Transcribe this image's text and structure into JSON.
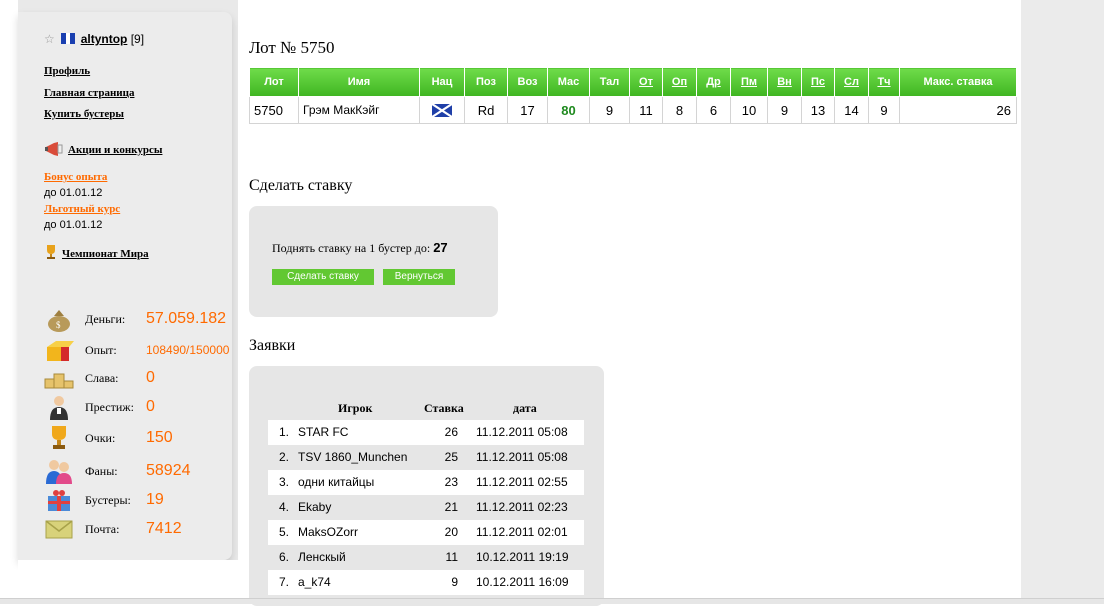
{
  "sidebar": {
    "username": "altyntop",
    "user_level": "[9]",
    "links": [
      "Профиль",
      "Главная страница",
      "Купить бустеры"
    ],
    "promo_label": "Акции и конкурсы",
    "bonus1_label": "Бонус опыта",
    "bonus1_date": "до 01.01.12",
    "bonus2_label": "Льготный курс",
    "bonus2_date": "до 01.01.12",
    "championship_label": "Чемпионат Мира",
    "stats": [
      {
        "label": "Деньги:",
        "value": "57.059.182",
        "icon": "money-bag-icon"
      },
      {
        "label": "Опыт:",
        "value": "108490/150000",
        "icon": "experience-icon"
      },
      {
        "label": "Слава:",
        "value": "0",
        "icon": "podium-icon"
      },
      {
        "label": "Престиж:",
        "value": "0",
        "icon": "prestige-icon"
      },
      {
        "label": "Очки:",
        "value": "150",
        "icon": "trophy-icon"
      },
      {
        "label": "Фаны:",
        "value": "58924",
        "icon": "fans-icon"
      },
      {
        "label": "Бустеры:",
        "value": "19",
        "icon": "gift-icon"
      },
      {
        "label": "Почта:",
        "value": "7412",
        "icon": "mail-icon"
      }
    ]
  },
  "lot": {
    "title": "Лот № 5750",
    "headers": [
      "Лот",
      "Имя",
      "Нац",
      "Поз",
      "Воз",
      "Мас",
      "Тал",
      "От",
      "Оп",
      "Др",
      "Пм",
      "Вн",
      "Пс",
      "Сл",
      "Тч",
      "Макс. ставка"
    ],
    "row": {
      "lot": "5750",
      "name": "Грэм МакКэйг",
      "nation_icon": "scotland-flag-icon",
      "position": "Rd",
      "age": "17",
      "mastery": "80",
      "talent": "9",
      "ot": "11",
      "op": "8",
      "dr": "6",
      "pm": "10",
      "vn": "9",
      "ps": "13",
      "sl": "14",
      "tch": "9",
      "max_bid": "26"
    }
  },
  "bid": {
    "section_title": "Сделать ставку",
    "text": "Поднять ставку на 1 бустер до:",
    "amount": "27",
    "submit_label": "Сделать ставку",
    "back_label": "Вернуться"
  },
  "applications": {
    "section_title": "Заявки",
    "headers": {
      "player": "Игрок",
      "bid": "Ставка",
      "date": "дата"
    },
    "rows": [
      {
        "num": "1.",
        "player": "STAR FC",
        "bid": "26",
        "date": "11.12.2011 05:08"
      },
      {
        "num": "2.",
        "player": "TSV 1860_Munchen",
        "bid": "25",
        "date": "11.12.2011 05:08"
      },
      {
        "num": "3.",
        "player": "одни китайцы",
        "bid": "23",
        "date": "11.12.2011 02:55"
      },
      {
        "num": "4.",
        "player": "Ekaby",
        "bid": "21",
        "date": "11.12.2011 02:23"
      },
      {
        "num": "5.",
        "player": "MaksOZorr",
        "bid": "20",
        "date": "11.12.2011 02:01"
      },
      {
        "num": "6.",
        "player": "Ленскый",
        "bid": "11",
        "date": "10.12.2011 19:19"
      },
      {
        "num": "7.",
        "player": "a_k74",
        "bid": "9",
        "date": "10.12.2011 16:09"
      }
    ]
  },
  "colors": {
    "accent_green": "#4cc22a",
    "orange": "#ff6a00",
    "mastery_green": "#1f8a1f"
  }
}
